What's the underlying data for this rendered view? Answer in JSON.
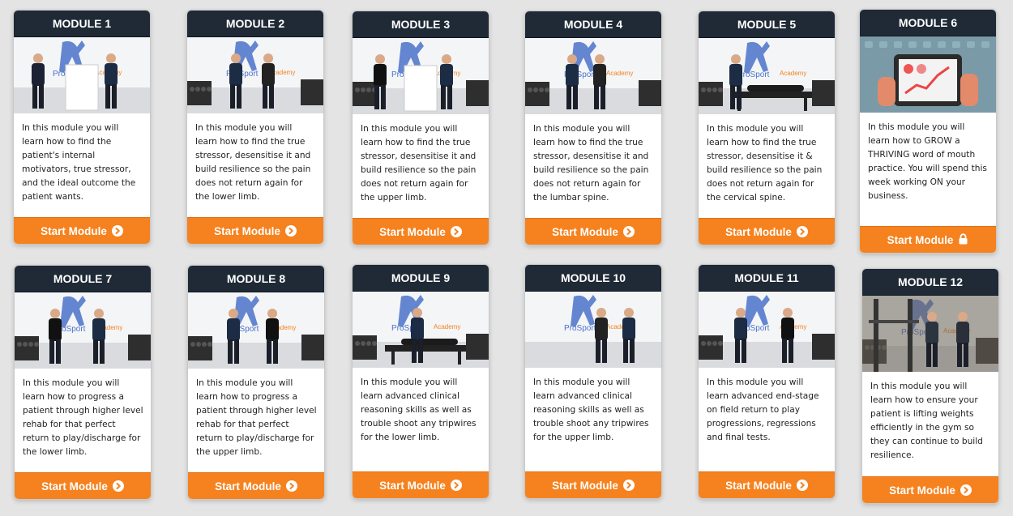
{
  "modules": [
    {
      "title": "MODULE 1",
      "description": "In this module you will learn how to find the patient's internal motivators, true stressor, and the ideal outcome the patient wants.",
      "button": "Start Module",
      "button_icon": "chevron-circle-right-icon",
      "locked": false,
      "image": "clinicians-standing-whiteboard"
    },
    {
      "title": "MODULE 2",
      "description": "In this module you will learn how to find the true stressor, desensitise it and build resilience so the pain does not return again for the lower limb.",
      "button": "Start Module",
      "button_icon": "chevron-circle-right-icon",
      "locked": false,
      "image": "gym-squat-demo"
    },
    {
      "title": "MODULE 3",
      "description": "In this module you will learn how to find the true stressor, desensitise it and build resilience so the pain does not return again for the upper limb.",
      "button": "Start Module",
      "button_icon": "chevron-circle-right-icon",
      "locked": false,
      "image": "clinicians-whiteboard"
    },
    {
      "title": "MODULE 4",
      "description": "In this module you will learn how to find the true stressor, desensitise it and build resilience so the pain does not return again for the lumbar spine.",
      "button": "Start Module",
      "button_icon": "chevron-circle-right-icon",
      "locked": false,
      "image": "kneeling-stretch-demo"
    },
    {
      "title": "MODULE 5",
      "description": "In this module you will learn how to find the true stressor, desensitise it & build resilience so the pain does not return again for the cervical spine.",
      "button": "Start Module",
      "button_icon": "chevron-circle-right-icon",
      "locked": false,
      "image": "treatment-table"
    },
    {
      "title": "MODULE 6",
      "description": "In this module you will learn how to GROW a THRIVING word of mouth practice. You will spend this week working ON your business.",
      "button": "Start Module",
      "button_icon": "lock-icon",
      "locked": true,
      "image": "tablet-graph-illustration"
    },
    {
      "title": "MODULE 7",
      "description": "In this module you will learn how to progress a patient through higher level rehab for that perfect return to play/discharge for the lower limb.",
      "button": "Start Module",
      "button_icon": "chevron-circle-right-icon",
      "locked": false,
      "image": "step-up-rehab"
    },
    {
      "title": "MODULE 8",
      "description": "In this module you will learn how to progress a patient through higher level rehab for that perfect return to play/discharge for the upper limb.",
      "button": "Start Module",
      "button_icon": "chevron-circle-right-icon",
      "locked": false,
      "image": "upper-limb-rehab"
    },
    {
      "title": "MODULE 9",
      "description": "In this module you will learn advanced clinical reasoning skills as well as trouble shoot any tripwires for the lower limb.",
      "button": "Start Module",
      "button_icon": "chevron-circle-right-icon",
      "locked": false,
      "image": "lying-assessment"
    },
    {
      "title": "MODULE 10",
      "description": "In this module you will learn advanced clinical reasoning skills as well as trouble shoot any tripwires for the upper limb.",
      "button": "Start Module",
      "button_icon": "chevron-circle-right-icon",
      "locked": false,
      "image": "wall-assessment"
    },
    {
      "title": "MODULE 11",
      "description": "In this module you will learn advanced end-stage on field return to play progressions, regressions and final tests.",
      "button": "Start Module",
      "button_icon": "chevron-circle-right-icon",
      "locked": false,
      "image": "field-tests"
    },
    {
      "title": "MODULE 12",
      "description": "In this module you will learn how to ensure your patient is lifting weights efficiently in the gym so they can continue to build resilience.",
      "button": "Start Module",
      "button_icon": "chevron-circle-right-icon",
      "locked": false,
      "image": "gym-rack-lifting"
    }
  ],
  "watermark": "ProSport",
  "watermark_suffix": "Academy",
  "colors": {
    "header_bg": "#1f2a36",
    "button_bg": "#f5821f",
    "card_bg": "#ffffff",
    "page_bg": "#e4e4e4",
    "brand_blue": "#3a64c8"
  }
}
